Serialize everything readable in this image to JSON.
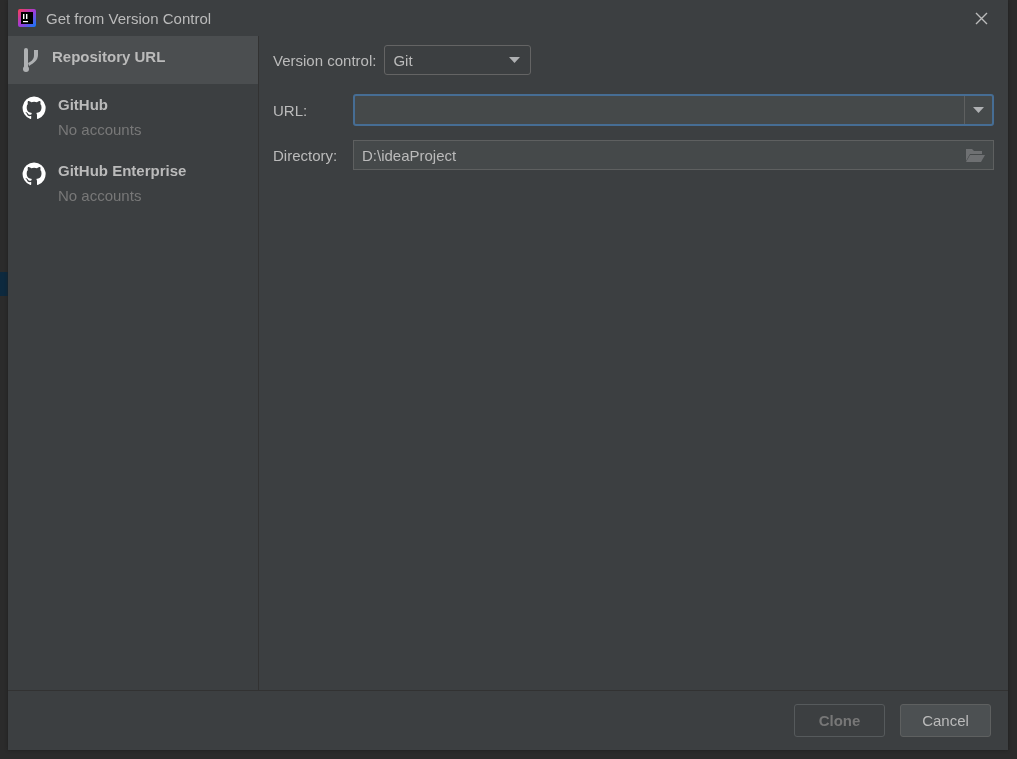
{
  "window": {
    "title": "Get from Version Control"
  },
  "sidebar": {
    "items": [
      {
        "kind": "repository",
        "label": "Repository URL",
        "selected": true
      },
      {
        "kind": "github",
        "label": "GitHub",
        "subtitle": "No accounts",
        "selected": false
      },
      {
        "kind": "github",
        "label": "GitHub Enterprise",
        "subtitle": "No accounts",
        "selected": false
      }
    ]
  },
  "form": {
    "version_control": {
      "label": "Version control:",
      "value": "Git"
    },
    "url": {
      "label": "URL:",
      "focused": true
    },
    "directory": {
      "label": "Directory:",
      "value": "D:\\ideaProject"
    }
  },
  "buttons": [
    {
      "label": "Clone",
      "disabled": true
    },
    {
      "label": "Cancel",
      "disabled": false
    }
  ]
}
